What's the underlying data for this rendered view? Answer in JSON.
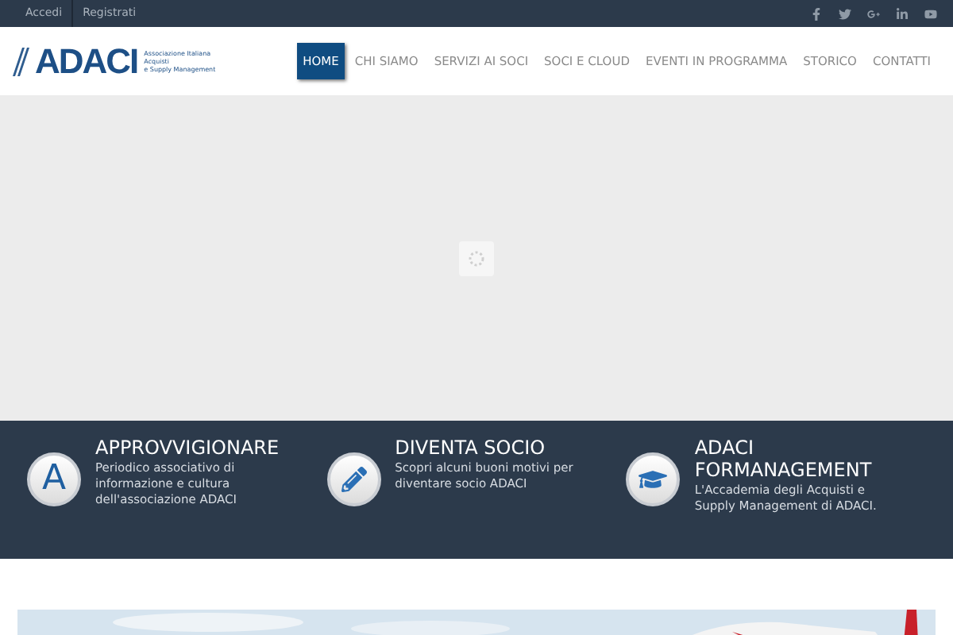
{
  "top_bar": {
    "links": [
      "Accedi",
      "Registrati"
    ],
    "social": [
      {
        "kind": "facebook"
      },
      {
        "kind": "twitter"
      },
      {
        "kind": "googleplus"
      },
      {
        "kind": "linkedin"
      },
      {
        "kind": "youtube"
      }
    ]
  },
  "logo": {
    "mark": "ADACI",
    "tagline": [
      "Associazione Italiana",
      "Acquisti",
      "e Supply Management"
    ]
  },
  "nav": [
    {
      "label": "HOME",
      "selected": true
    },
    {
      "label": "CHI SIAMO",
      "selected": false
    },
    {
      "label": "SERVIZI AI SOCI",
      "selected": false
    },
    {
      "label": "SOCI E CLOUD",
      "selected": false
    },
    {
      "label": "EVENTI IN PROGRAMMA",
      "selected": false
    },
    {
      "label": "STORICO",
      "selected": false
    },
    {
      "label": "CONTATTI",
      "selected": false
    }
  ],
  "features": [
    {
      "kind": "letter",
      "icon_text": "A",
      "title": "APPROVVIGIONARE",
      "text": "Periodico associativo di informazione e cultura dell'associazione ADACI"
    },
    {
      "kind": "pencil",
      "title": "DIVENTA SOCIO",
      "text": "Scopri alcuni buoni motivi per diventare socio ADACI"
    },
    {
      "kind": "cap",
      "title": "ADACI FORMANAGEMENT",
      "text": "L'Accademia degli Acquisti e Supply Management di ADACI."
    }
  ]
}
